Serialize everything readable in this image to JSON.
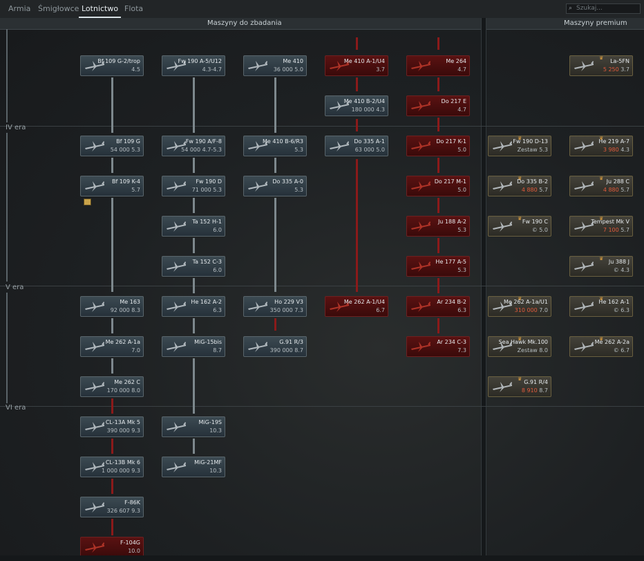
{
  "tabs": [
    "Armia",
    "Śmigłowce",
    "Lotnictwo",
    "Flota"
  ],
  "active_tab": "Lotnictwo",
  "search_placeholder": "Szukaj...",
  "headers": {
    "research": "Maszyny do zbadania",
    "premium": "Maszyny premium"
  },
  "eras": {
    "iv": "IV era",
    "v": "V era",
    "vi": "VI era"
  },
  "cards": [
    {
      "name": "Bf 109 G-2/trop",
      "br": "4.5",
      "cost": "",
      "kind": "std"
    },
    {
      "name": "Fw 190 A-5/U12",
      "br": "4.3-4.7",
      "cost": "",
      "kind": "std"
    },
    {
      "name": "Me 410",
      "br": "5.0",
      "cost": "36 000",
      "kind": "std"
    },
    {
      "name": "Me 410 A-1/U4",
      "br": "3.7",
      "cost": "",
      "kind": "red"
    },
    {
      "name": "Me 264",
      "br": "4.7",
      "cost": "",
      "kind": "red"
    },
    {
      "name": "Me 410 B-2/U4",
      "br": "4.3",
      "cost": "180 000",
      "kind": "std"
    },
    {
      "name": "Do 217 E",
      "br": "4.7",
      "cost": "",
      "kind": "red"
    },
    {
      "name": "Bf 109 G",
      "br": "5.3",
      "cost": "54 000",
      "kind": "std"
    },
    {
      "name": "Fw 190 A/F-8",
      "br": "4.7-5.3",
      "cost": "54 000",
      "kind": "std"
    },
    {
      "name": "Me 410 B-6/R3",
      "br": "5.3",
      "cost": "",
      "kind": "std"
    },
    {
      "name": "Do 335 A-1",
      "br": "5.0",
      "cost": "63 000",
      "kind": "std"
    },
    {
      "name": "Do 217 K-1",
      "br": "5.0",
      "cost": "",
      "kind": "red"
    },
    {
      "name": "Fw 190 D-13",
      "br": "5.3",
      "cost": "Zestaw",
      "kind": "prem"
    },
    {
      "name": "He 219 A-7",
      "br": "4.3",
      "cost": "3 980",
      "kind": "prem"
    },
    {
      "name": "Bf 109 K-4",
      "br": "5.7",
      "cost": "",
      "kind": "std"
    },
    {
      "name": "Fw 190 D",
      "br": "5.3",
      "cost": "71 000",
      "kind": "std"
    },
    {
      "name": "Do 335 A-0",
      "br": "5.3",
      "cost": "",
      "kind": "std"
    },
    {
      "name": "Do 217 M-1",
      "br": "5.0",
      "cost": "",
      "kind": "red"
    },
    {
      "name": "Do 335 B-2",
      "br": "5.7",
      "cost": "4 880",
      "kind": "prem"
    },
    {
      "name": "Ju 288 C",
      "br": "5.7",
      "cost": "4 880",
      "kind": "prem"
    },
    {
      "name": "Ta 152 H-1",
      "br": "6.0",
      "cost": "",
      "kind": "std"
    },
    {
      "name": "Ju 188 A-2",
      "br": "5.3",
      "cost": "",
      "kind": "red"
    },
    {
      "name": "Fw 190 C",
      "br": "5.0",
      "cost": "©",
      "kind": "prem"
    },
    {
      "name": "Tempest Mk V",
      "br": "5.7",
      "cost": "7 100",
      "kind": "prem"
    },
    {
      "name": "Ta 152 C-3",
      "br": "6.0",
      "cost": "",
      "kind": "std"
    },
    {
      "name": "He 177 A-5",
      "br": "5.3",
      "cost": "",
      "kind": "red"
    },
    {
      "name": "Ju 388 J",
      "br": "4.3",
      "cost": "©",
      "kind": "prem"
    },
    {
      "name": "Me 163",
      "br": "8.3",
      "cost": "92 000",
      "kind": "std"
    },
    {
      "name": "He 162 A-2",
      "br": "6.3",
      "cost": "",
      "kind": "std"
    },
    {
      "name": "Ho 229 V3",
      "br": "7.3",
      "cost": "350 000",
      "kind": "std"
    },
    {
      "name": "Me 262 A-1/U4",
      "br": "6.7",
      "cost": "",
      "kind": "red"
    },
    {
      "name": "Ar 234 B-2",
      "br": "6.3",
      "cost": "",
      "kind": "red"
    },
    {
      "name": "Me 262 A-1a/U1",
      "br": "7.0",
      "cost": "310 000",
      "kind": "prem"
    },
    {
      "name": "He 162 A-1",
      "br": "6.3",
      "cost": "©",
      "kind": "prem"
    },
    {
      "name": "Me 262 A-1a",
      "br": "7.0",
      "cost": "",
      "kind": "std"
    },
    {
      "name": "MiG-15bis",
      "br": "8.7",
      "cost": "",
      "kind": "std"
    },
    {
      "name": "G.91 R/3",
      "br": "8.7",
      "cost": "390 000",
      "kind": "std"
    },
    {
      "name": "Ar 234 C-3",
      "br": "7.3",
      "cost": "",
      "kind": "red"
    },
    {
      "name": "Sea Hawk Mk.100",
      "br": "8.0",
      "cost": "Zestaw",
      "kind": "prem"
    },
    {
      "name": "Me 262 A-2a",
      "br": "6.7",
      "cost": "©",
      "kind": "prem"
    },
    {
      "name": "Me 262 C",
      "br": "8.0",
      "cost": "170 000",
      "kind": "std"
    },
    {
      "name": "G.91 R/4",
      "br": "8.7",
      "cost": "8 910",
      "kind": "prem"
    },
    {
      "name": "CL-13A Mk 5",
      "br": "9.3",
      "cost": "390 000",
      "kind": "std"
    },
    {
      "name": "MiG-19S",
      "br": "10.3",
      "cost": "",
      "kind": "std"
    },
    {
      "name": "CL-13B Mk 6",
      "br": "9.3",
      "cost": "1 000 000",
      "kind": "std"
    },
    {
      "name": "MiG-21MF",
      "br": "10.3",
      "cost": "",
      "kind": "std"
    },
    {
      "name": "F-86K",
      "br": "9.3",
      "cost": "326 607",
      "kind": "std"
    },
    {
      "name": "F-104G",
      "br": "10.0",
      "cost": "",
      "kind": "red"
    },
    {
      "name": "La-5FN",
      "br": "3.7",
      "cost": "5 250",
      "kind": "prem"
    }
  ],
  "colors": {
    "bg": "#1b1e20",
    "card": "#33414a",
    "research_red": "#5a1212",
    "premium_gold": "#6a6040",
    "cost_gold": "#e05a3c"
  }
}
